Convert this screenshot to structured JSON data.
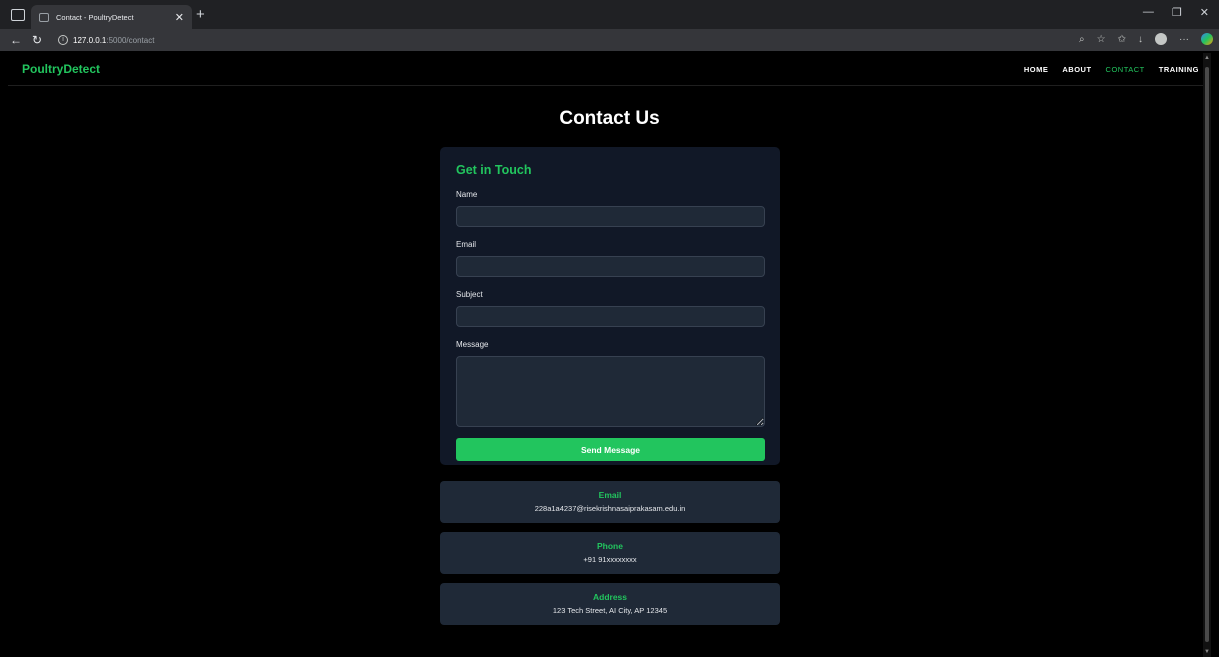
{
  "browser": {
    "tab_title": "Contact - PoultryDetect",
    "url_host": "127.0.0.1",
    "url_path": ":5000/contact"
  },
  "navbar": {
    "brand": "PoultryDetect",
    "links": [
      "HOME",
      "ABOUT",
      "CONTACT",
      "TRAINING"
    ],
    "active": "CONTACT"
  },
  "page": {
    "title": "Contact Us"
  },
  "form": {
    "heading": "Get in Touch",
    "name_label": "Name",
    "name_value": "",
    "email_label": "Email",
    "email_value": "",
    "subject_label": "Subject",
    "subject_value": "",
    "message_label": "Message",
    "message_value": "",
    "submit_label": "Send Message"
  },
  "info": [
    {
      "title": "Email",
      "value": "228a1a4237@risekrishnasaiprakasam.edu.in"
    },
    {
      "title": "Phone",
      "value": "+91 91xxxxxxxx"
    },
    {
      "title": "Address",
      "value": "123 Tech Street, AI City, AP 12345"
    }
  ],
  "colors": {
    "accent": "#22c55e",
    "card": "#111827",
    "input": "#1f2937"
  }
}
